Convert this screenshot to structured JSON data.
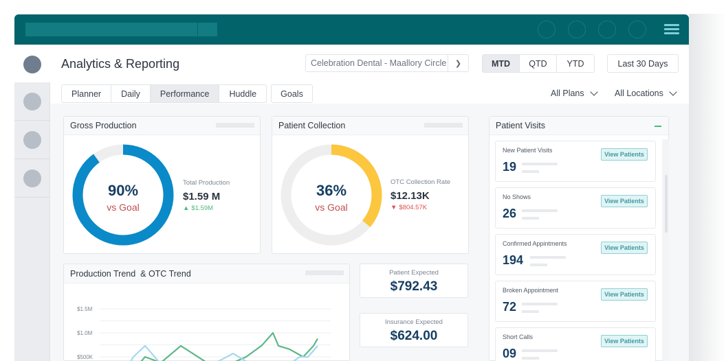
{
  "app": {
    "title": "Analytics & Reporting",
    "menu_icon": "hamburger-menu-icon"
  },
  "header": {
    "location": "Celebration Dental - Maallory Circle",
    "periods": [
      "MTD",
      "QTD",
      "YTD"
    ],
    "active_period": "MTD",
    "date_range": "Last 30 Days"
  },
  "tabs": {
    "items": [
      "Planner",
      "Daily",
      "Performance",
      "Huddle"
    ],
    "active": "Performance",
    "goals": "Goals"
  },
  "filters": {
    "plans": "All Plans",
    "locations": "All Locations"
  },
  "gross_production": {
    "title": "Gross Production",
    "percent": "90%",
    "percent_value": 0.9,
    "vs_label": "vs Goal",
    "kpi_label": "Total Production",
    "kpi_value": "$1.59 M",
    "delta": "$1.59M",
    "delta_direction": "up",
    "color": "#0a8ac8"
  },
  "patient_collection": {
    "title": "Patient Collection",
    "percent": "36%",
    "percent_value": 0.36,
    "vs_label": "vs Goal",
    "kpi_label": "OTC Collection Rate",
    "kpi_value": "$12.13K",
    "delta": "$804.57K",
    "delta_direction": "down",
    "color": "#fcc63e"
  },
  "expected": {
    "patient_label": "Patient Expected",
    "patient_value": "$792.43",
    "insurance_label": "Insurance Expected",
    "insurance_value": "$624.00"
  },
  "patient_visits": {
    "title": "Patient Visits",
    "button_label": "View Patients",
    "items": [
      {
        "label": "New Patient Visits",
        "value": "19"
      },
      {
        "label": "No Shows",
        "value": "26"
      },
      {
        "label": "Confirmed Appintments",
        "value": "194"
      },
      {
        "label": "Broken Appointment",
        "value": "72"
      },
      {
        "label": "Short Calls",
        "value": "09"
      }
    ]
  },
  "chart_data": {
    "type": "line",
    "title": "Production Trend  & OTC Trend",
    "xlabel": "",
    "ylabel": "",
    "y_ticks": [
      "$1.5M",
      "$1.0M",
      "$500K"
    ],
    "y_tick_values": [
      1500000,
      1000000,
      500000
    ],
    "ylim": [
      300000,
      1500000
    ],
    "grid": true,
    "x": [
      0,
      1,
      2,
      3,
      4,
      5,
      6,
      7,
      8,
      9,
      10,
      11,
      12,
      13,
      14,
      15,
      16,
      17,
      18,
      19,
      20,
      21
    ],
    "series": [
      {
        "name": "Production Trend",
        "color": "#5cb887",
        "points": [
          [
            204,
            400000
          ],
          [
            210,
            500000
          ],
          [
            233,
            380000
          ],
          [
            262,
            730000
          ],
          [
            300,
            380000
          ],
          [
            338,
            380000
          ],
          [
            357,
            500000
          ],
          [
            380,
            740000
          ],
          [
            396,
            1000000
          ],
          [
            404,
            730000
          ],
          [
            420,
            660000
          ],
          [
            440,
            500000
          ],
          [
            455,
            730000
          ],
          [
            461,
            880000
          ]
        ]
      },
      {
        "name": "OTC Trend",
        "color": "#a6d8ef",
        "points": [
          [
            188,
            380000
          ],
          [
            193,
            500000
          ],
          [
            210,
            730000
          ],
          [
            230,
            400000
          ],
          [
            313,
            380000
          ],
          [
            338,
            570000
          ],
          [
            360,
            380000
          ],
          [
            423,
            380000
          ],
          [
            435,
            500000
          ],
          [
            447,
            500000
          ],
          [
            461,
            730000
          ]
        ]
      }
    ]
  }
}
